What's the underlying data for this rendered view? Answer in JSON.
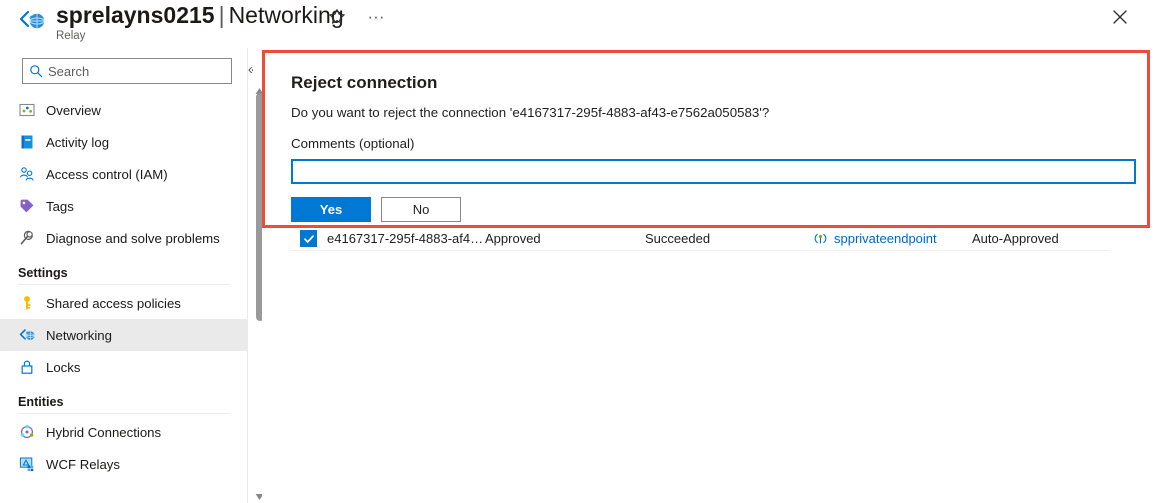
{
  "header": {
    "resource_name": "sprelayns0215",
    "separator": "|",
    "section": "Networking",
    "subtitle": "Relay",
    "logo_icon": "relay-resource-icon",
    "favorite_icon": "star-icon",
    "more_icon": "ellipsis-icon",
    "close_icon": "close-icon"
  },
  "sidebar": {
    "search": {
      "placeholder": "Search",
      "value": "",
      "icon": "search-icon"
    },
    "collapse_icon": "chevron-double-left-icon",
    "items": [
      {
        "label": "Overview",
        "icon": "overview-icon",
        "selected": false
      },
      {
        "label": "Activity log",
        "icon": "activity-log-icon",
        "selected": false
      },
      {
        "label": "Access control (IAM)",
        "icon": "access-control-icon",
        "selected": false
      },
      {
        "label": "Tags",
        "icon": "tags-icon",
        "selected": false
      },
      {
        "label": "Diagnose and solve problems",
        "icon": "diagnose-icon",
        "selected": false
      }
    ],
    "groups": [
      {
        "title": "Settings",
        "items": [
          {
            "label": "Shared access policies",
            "icon": "key-icon",
            "selected": false
          },
          {
            "label": "Networking",
            "icon": "networking-icon",
            "selected": true
          },
          {
            "label": "Locks",
            "icon": "lock-icon",
            "selected": false
          }
        ]
      },
      {
        "title": "Entities",
        "items": [
          {
            "label": "Hybrid Connections",
            "icon": "hybrid-connections-icon",
            "selected": false
          },
          {
            "label": "WCF Relays",
            "icon": "wcf-relays-icon",
            "selected": false
          }
        ]
      }
    ],
    "scrollbar": {
      "up_arrow_icon": "scroll-up-arrow-icon",
      "down_arrow_icon": "scroll-down-arrow-icon"
    }
  },
  "dialog": {
    "title": "Reject connection",
    "question": "Do you want to reject the connection 'e4167317-295f-4883-af43-e7562a050583'?",
    "comments_label": "Comments (optional)",
    "comments_value": "",
    "comments_placeholder": "",
    "yes_label": "Yes",
    "no_label": "No",
    "highlight_color": "#ed4c3b",
    "accent_color": "#0078d4"
  },
  "table": {
    "rows": [
      {
        "selected": true,
        "name": "e4167317-295f-4883-af4…",
        "connection_state": "Approved",
        "provisioning_state": "Succeeded",
        "endpoint_icon": "private-endpoint-icon",
        "private_endpoint": "spprivateendpoint",
        "description": "Auto-Approved"
      }
    ]
  }
}
